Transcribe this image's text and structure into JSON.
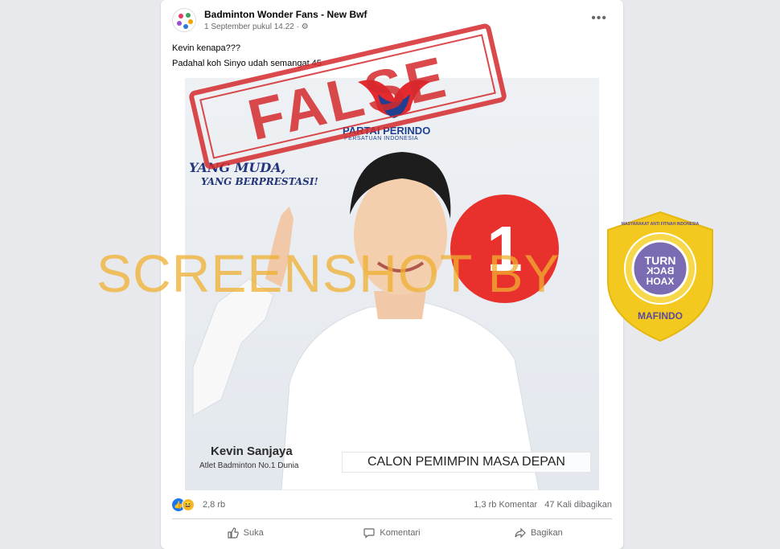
{
  "post": {
    "page_name": "Badminton Wonder Fans - New Bwf",
    "timestamp": "1 September pukul 14.22",
    "caption_line1": "Kevin kenapa???",
    "caption_line2": "Padahal koh Sinyo udah semangat 45"
  },
  "image": {
    "stamp_text": "FALSE",
    "party_name": "PARTAI PERINDO",
    "party_subtitle": "PERSATUAN INDONESIA",
    "slogan_line1": "YANG MUDA,",
    "slogan_line2": "YANG BERPRESTASI!",
    "ballot_number": "1",
    "candidate_name": "Kevin Sanjaya",
    "candidate_title": "Atlet Badminton No.1 Dunia",
    "tagline": "CALON PEMIMPIN MASA DEPAN",
    "watermark": "SCREENSHOT BY"
  },
  "badge": {
    "ring_text": "MASYARAKAT ANTI FITNAH INDONESIA",
    "line1": "TURN",
    "line2": "BACK",
    "line3": "HOAX",
    "org": "MAFINDO",
    "colors": {
      "ring": "#f3c91f",
      "center": "#7b6bb2"
    }
  },
  "engagement": {
    "reaction_count": "2,8 rb",
    "comments": "1,3 rb Komentar",
    "shares": "47 Kali dibagikan"
  },
  "actions": {
    "like": "Suka",
    "comment": "Komentari",
    "share": "Bagikan"
  }
}
